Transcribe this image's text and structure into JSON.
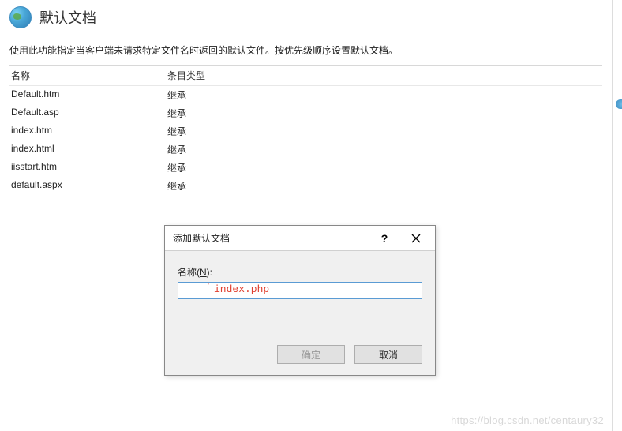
{
  "header": {
    "title": "默认文档"
  },
  "description": "使用此功能指定当客户端未请求特定文件名时返回的默认文件。按优先级顺序设置默认文档。",
  "grid": {
    "columns": {
      "name": "名称",
      "type": "条目类型"
    },
    "rows": [
      {
        "name": "Default.htm",
        "type": "继承"
      },
      {
        "name": "Default.asp",
        "type": "继承"
      },
      {
        "name": "index.htm",
        "type": "继承"
      },
      {
        "name": "index.html",
        "type": "继承"
      },
      {
        "name": "iisstart.htm",
        "type": "继承"
      },
      {
        "name": "default.aspx",
        "type": "继承"
      }
    ]
  },
  "dialog": {
    "title": "添加默认文档",
    "help_label": "?",
    "name_label_prefix": "名称(",
    "name_label_key": "N",
    "name_label_suffix": "):",
    "input_overlay": "index.php",
    "input_value": "",
    "ok": "确定",
    "cancel": "取消"
  },
  "watermark": "https://blog.csdn.net/centaury32"
}
